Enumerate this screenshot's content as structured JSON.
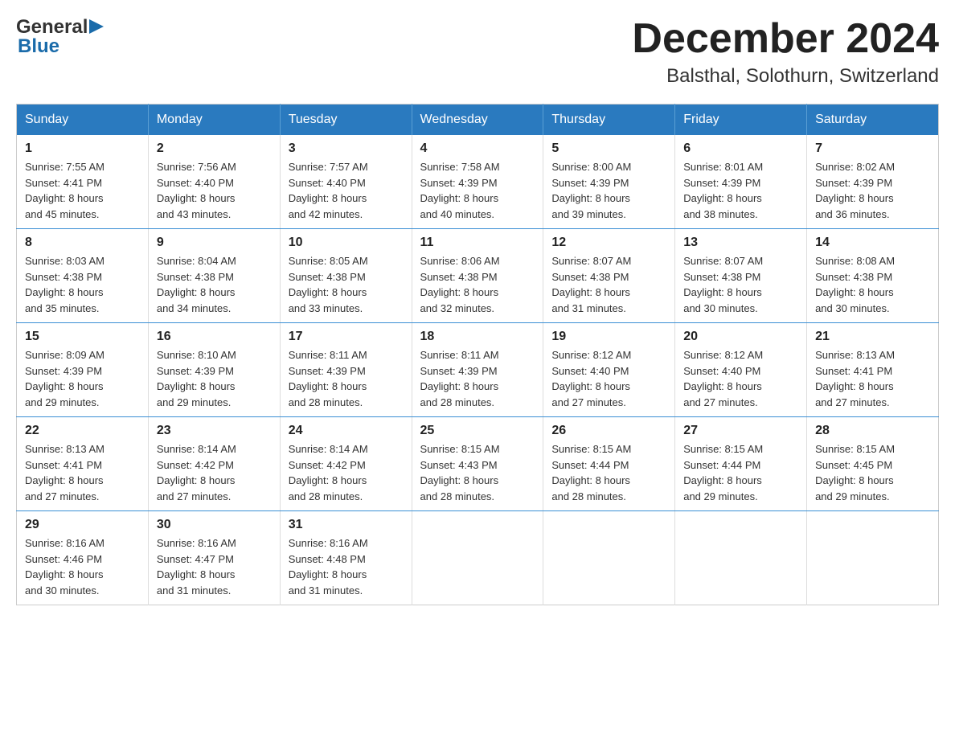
{
  "header": {
    "logo_text_general": "General",
    "logo_text_blue": "Blue",
    "month_title": "December 2024",
    "location": "Balsthal, Solothurn, Switzerland"
  },
  "weekdays": [
    "Sunday",
    "Monday",
    "Tuesday",
    "Wednesday",
    "Thursday",
    "Friday",
    "Saturday"
  ],
  "weeks": [
    [
      {
        "day": "1",
        "sunrise": "Sunrise: 7:55 AM",
        "sunset": "Sunset: 4:41 PM",
        "daylight": "Daylight: 8 hours",
        "daylight2": "and 45 minutes."
      },
      {
        "day": "2",
        "sunrise": "Sunrise: 7:56 AM",
        "sunset": "Sunset: 4:40 PM",
        "daylight": "Daylight: 8 hours",
        "daylight2": "and 43 minutes."
      },
      {
        "day": "3",
        "sunrise": "Sunrise: 7:57 AM",
        "sunset": "Sunset: 4:40 PM",
        "daylight": "Daylight: 8 hours",
        "daylight2": "and 42 minutes."
      },
      {
        "day": "4",
        "sunrise": "Sunrise: 7:58 AM",
        "sunset": "Sunset: 4:39 PM",
        "daylight": "Daylight: 8 hours",
        "daylight2": "and 40 minutes."
      },
      {
        "day": "5",
        "sunrise": "Sunrise: 8:00 AM",
        "sunset": "Sunset: 4:39 PM",
        "daylight": "Daylight: 8 hours",
        "daylight2": "and 39 minutes."
      },
      {
        "day": "6",
        "sunrise": "Sunrise: 8:01 AM",
        "sunset": "Sunset: 4:39 PM",
        "daylight": "Daylight: 8 hours",
        "daylight2": "and 38 minutes."
      },
      {
        "day": "7",
        "sunrise": "Sunrise: 8:02 AM",
        "sunset": "Sunset: 4:39 PM",
        "daylight": "Daylight: 8 hours",
        "daylight2": "and 36 minutes."
      }
    ],
    [
      {
        "day": "8",
        "sunrise": "Sunrise: 8:03 AM",
        "sunset": "Sunset: 4:38 PM",
        "daylight": "Daylight: 8 hours",
        "daylight2": "and 35 minutes."
      },
      {
        "day": "9",
        "sunrise": "Sunrise: 8:04 AM",
        "sunset": "Sunset: 4:38 PM",
        "daylight": "Daylight: 8 hours",
        "daylight2": "and 34 minutes."
      },
      {
        "day": "10",
        "sunrise": "Sunrise: 8:05 AM",
        "sunset": "Sunset: 4:38 PM",
        "daylight": "Daylight: 8 hours",
        "daylight2": "and 33 minutes."
      },
      {
        "day": "11",
        "sunrise": "Sunrise: 8:06 AM",
        "sunset": "Sunset: 4:38 PM",
        "daylight": "Daylight: 8 hours",
        "daylight2": "and 32 minutes."
      },
      {
        "day": "12",
        "sunrise": "Sunrise: 8:07 AM",
        "sunset": "Sunset: 4:38 PM",
        "daylight": "Daylight: 8 hours",
        "daylight2": "and 31 minutes."
      },
      {
        "day": "13",
        "sunrise": "Sunrise: 8:07 AM",
        "sunset": "Sunset: 4:38 PM",
        "daylight": "Daylight: 8 hours",
        "daylight2": "and 30 minutes."
      },
      {
        "day": "14",
        "sunrise": "Sunrise: 8:08 AM",
        "sunset": "Sunset: 4:38 PM",
        "daylight": "Daylight: 8 hours",
        "daylight2": "and 30 minutes."
      }
    ],
    [
      {
        "day": "15",
        "sunrise": "Sunrise: 8:09 AM",
        "sunset": "Sunset: 4:39 PM",
        "daylight": "Daylight: 8 hours",
        "daylight2": "and 29 minutes."
      },
      {
        "day": "16",
        "sunrise": "Sunrise: 8:10 AM",
        "sunset": "Sunset: 4:39 PM",
        "daylight": "Daylight: 8 hours",
        "daylight2": "and 29 minutes."
      },
      {
        "day": "17",
        "sunrise": "Sunrise: 8:11 AM",
        "sunset": "Sunset: 4:39 PM",
        "daylight": "Daylight: 8 hours",
        "daylight2": "and 28 minutes."
      },
      {
        "day": "18",
        "sunrise": "Sunrise: 8:11 AM",
        "sunset": "Sunset: 4:39 PM",
        "daylight": "Daylight: 8 hours",
        "daylight2": "and 28 minutes."
      },
      {
        "day": "19",
        "sunrise": "Sunrise: 8:12 AM",
        "sunset": "Sunset: 4:40 PM",
        "daylight": "Daylight: 8 hours",
        "daylight2": "and 27 minutes."
      },
      {
        "day": "20",
        "sunrise": "Sunrise: 8:12 AM",
        "sunset": "Sunset: 4:40 PM",
        "daylight": "Daylight: 8 hours",
        "daylight2": "and 27 minutes."
      },
      {
        "day": "21",
        "sunrise": "Sunrise: 8:13 AM",
        "sunset": "Sunset: 4:41 PM",
        "daylight": "Daylight: 8 hours",
        "daylight2": "and 27 minutes."
      }
    ],
    [
      {
        "day": "22",
        "sunrise": "Sunrise: 8:13 AM",
        "sunset": "Sunset: 4:41 PM",
        "daylight": "Daylight: 8 hours",
        "daylight2": "and 27 minutes."
      },
      {
        "day": "23",
        "sunrise": "Sunrise: 8:14 AM",
        "sunset": "Sunset: 4:42 PM",
        "daylight": "Daylight: 8 hours",
        "daylight2": "and 27 minutes."
      },
      {
        "day": "24",
        "sunrise": "Sunrise: 8:14 AM",
        "sunset": "Sunset: 4:42 PM",
        "daylight": "Daylight: 8 hours",
        "daylight2": "and 28 minutes."
      },
      {
        "day": "25",
        "sunrise": "Sunrise: 8:15 AM",
        "sunset": "Sunset: 4:43 PM",
        "daylight": "Daylight: 8 hours",
        "daylight2": "and 28 minutes."
      },
      {
        "day": "26",
        "sunrise": "Sunrise: 8:15 AM",
        "sunset": "Sunset: 4:44 PM",
        "daylight": "Daylight: 8 hours",
        "daylight2": "and 28 minutes."
      },
      {
        "day": "27",
        "sunrise": "Sunrise: 8:15 AM",
        "sunset": "Sunset: 4:44 PM",
        "daylight": "Daylight: 8 hours",
        "daylight2": "and 29 minutes."
      },
      {
        "day": "28",
        "sunrise": "Sunrise: 8:15 AM",
        "sunset": "Sunset: 4:45 PM",
        "daylight": "Daylight: 8 hours",
        "daylight2": "and 29 minutes."
      }
    ],
    [
      {
        "day": "29",
        "sunrise": "Sunrise: 8:16 AM",
        "sunset": "Sunset: 4:46 PM",
        "daylight": "Daylight: 8 hours",
        "daylight2": "and 30 minutes."
      },
      {
        "day": "30",
        "sunrise": "Sunrise: 8:16 AM",
        "sunset": "Sunset: 4:47 PM",
        "daylight": "Daylight: 8 hours",
        "daylight2": "and 31 minutes."
      },
      {
        "day": "31",
        "sunrise": "Sunrise: 8:16 AM",
        "sunset": "Sunset: 4:48 PM",
        "daylight": "Daylight: 8 hours",
        "daylight2": "and 31 minutes."
      },
      null,
      null,
      null,
      null
    ]
  ]
}
